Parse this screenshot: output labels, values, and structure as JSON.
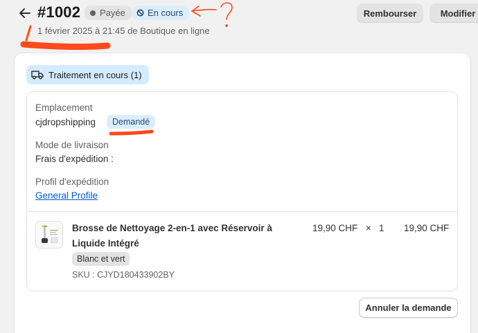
{
  "header": {
    "order_number": "#1002",
    "payment_status": "Payée",
    "fulfillment_status": "En cours",
    "subtitle": "1 février 2025 à 21:45 de Boutique en ligne",
    "refund_label": "Rembourser",
    "edit_label": "Modifier"
  },
  "fulfillment": {
    "badge_label": "Traitement en cours (1)",
    "location_label": "Emplacement",
    "location_value": "cjdropshipping",
    "request_badge": "Demandé",
    "delivery_label": "Mode de livraison",
    "delivery_value": "Frais d'expédition :",
    "profile_label": "Profil d'expédition",
    "profile_link": "General Profile",
    "item": {
      "title": "Brosse de Nettoyage 2-en-1 avec Réservoir à Liquide Intégré",
      "variant": "Blanc et vert",
      "sku": "SKU : CJYD180433902BY",
      "unit_price": "19,90 CHF",
      "times": "×",
      "quantity": "1",
      "total": "19,90 CHF"
    },
    "cancel_label": "Annuler la demande"
  },
  "colors": {
    "annotation": "#ff4a1a",
    "link": "#005bd3",
    "badge_blue": "#dceefb"
  }
}
